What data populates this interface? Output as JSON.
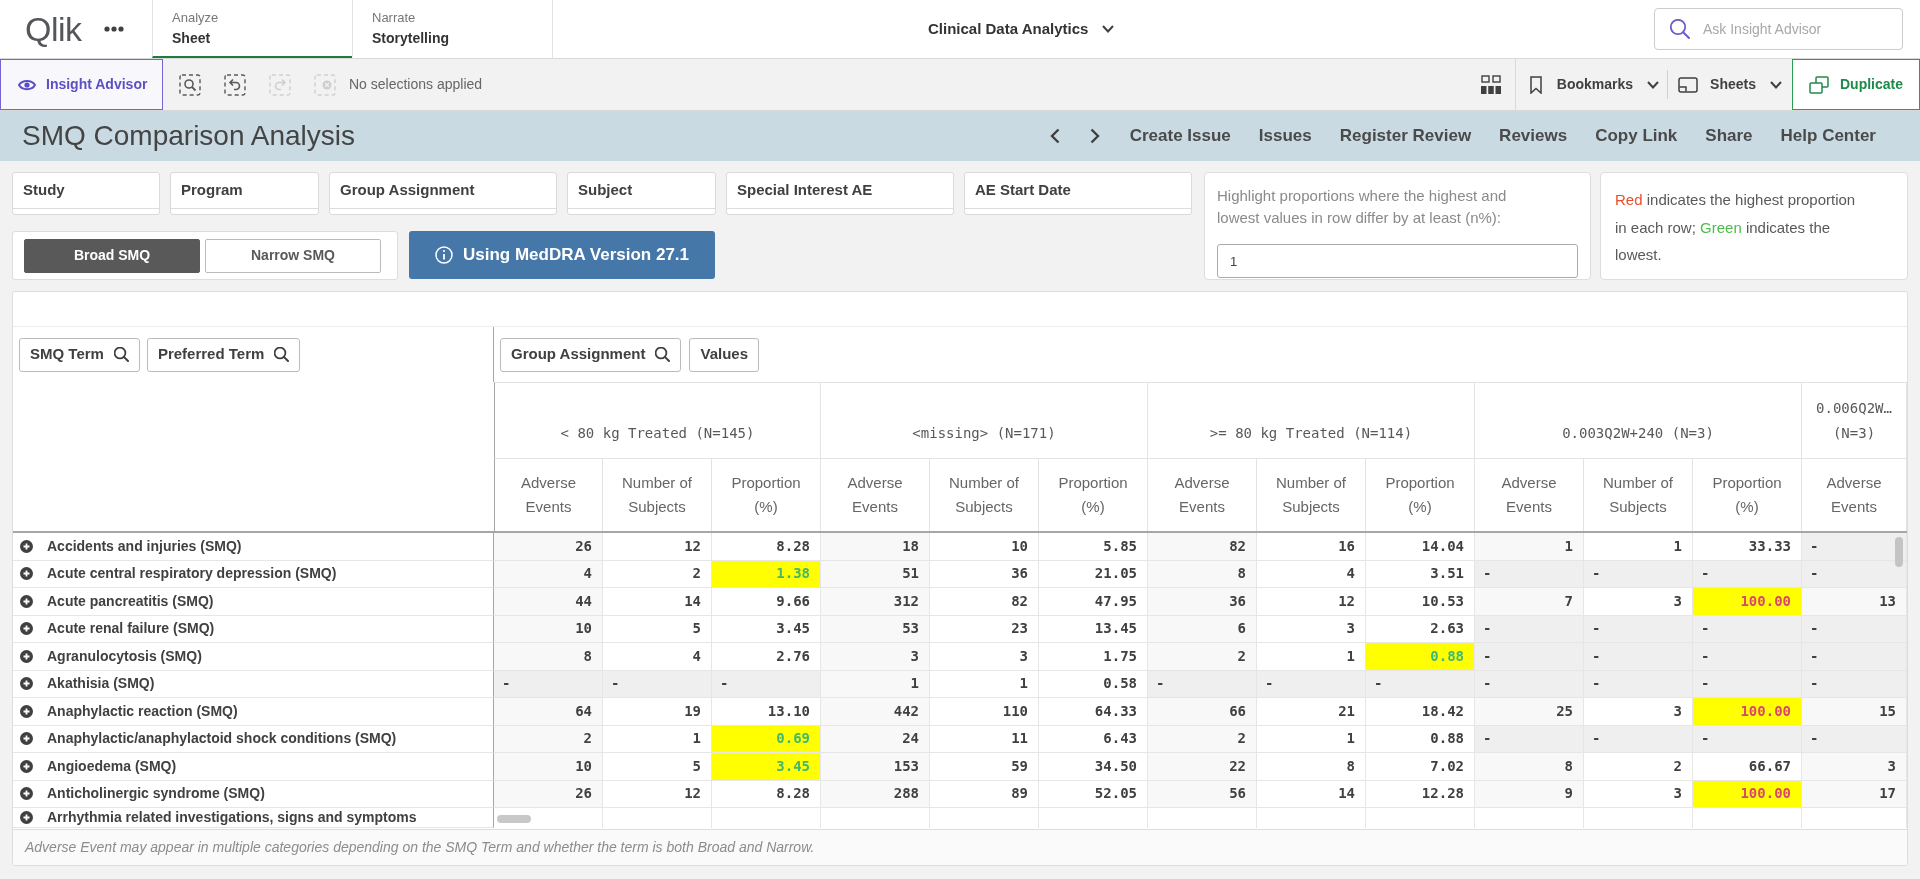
{
  "app_header": {
    "logo": "Qlik",
    "tabs": [
      {
        "category": "Analyze",
        "label": "Sheet",
        "selected": true
      },
      {
        "category": "Narrate",
        "label": "Storytelling",
        "selected": false
      }
    ],
    "app_title": "Clinical Data Analytics",
    "search": {
      "placeholder": "Ask Insight Advisor"
    }
  },
  "toolbar": {
    "insight_advisor": "Insight Advisor",
    "selection_tools": [
      {
        "kind": "search",
        "disabled": false
      },
      {
        "kind": "back",
        "disabled": false
      },
      {
        "kind": "forward",
        "disabled": true
      },
      {
        "kind": "clear",
        "disabled": true
      }
    ],
    "selections_status": "No selections applied",
    "bookmarks": "Bookmarks",
    "sheets": "Sheets",
    "duplicate": "Duplicate"
  },
  "sheet_bar": {
    "title": "SMQ Comparison Analysis",
    "links": [
      "Create Issue",
      "Issues",
      "Register Review",
      "Reviews",
      "Copy Link",
      "Share",
      "Help Center"
    ]
  },
  "filters": [
    "Study",
    "Program",
    "Group Assignment",
    "Subject",
    "Special Interest AE",
    "AE Start Date"
  ],
  "smq_scope": [
    {
      "label": "Broad SMQ",
      "selected": true
    },
    {
      "label": "Narrow SMQ",
      "selected": false
    }
  ],
  "meddra_button": "Using MedDRA Version 27.1",
  "highlight_setting": {
    "label": "Highlight proportions where the highest and lowest values in row differ by at least (n%):",
    "value": "1"
  },
  "legend": [
    {
      "text": "Red",
      "color": "#e94e2b"
    },
    {
      "text": "indicates the highest proportion in each row;",
      "color": "#595959"
    },
    {
      "text": "Green",
      "color": "#4cbb4c"
    },
    {
      "text": "indicates the lowest.",
      "color": "#595959"
    }
  ],
  "table": {
    "row_dimensions": [
      {
        "label": "SMQ Term",
        "search": true
      },
      {
        "label": "Preferred Term",
        "search": true
      }
    ],
    "column_dimensions": [
      {
        "label": "Group Assignment",
        "search": true
      },
      {
        "label": "Values",
        "search": false
      }
    ],
    "groups": [
      {
        "label": "< 80 kg Treated (N=145)",
        "columns": [
          "Adverse Events",
          "Number of Subjects",
          "Proportion (%)"
        ]
      },
      {
        "label": "<missing> (N=171)",
        "columns": [
          "Adverse Events",
          "Number of Subjects",
          "Proportion (%)"
        ]
      },
      {
        "label": ">= 80 kg Treated (N=114)",
        "columns": [
          "Adverse Events",
          "Number of Subjects",
          "Proportion (%)"
        ]
      },
      {
        "label": "0.003Q2W+240 (N=3)",
        "columns": [
          "Adverse Events",
          "Number of Subjects",
          "Proportion (%)"
        ]
      },
      {
        "label": "0.006Q2W… (N=3)",
        "columns": [
          "Adverse Events"
        ]
      }
    ],
    "rows": [
      {
        "term": "Accidents and injuries (SMQ)",
        "expanded": false,
        "groups": [
          {
            "adverse_events": "26",
            "subjects": "12",
            "proportion": "8.28",
            "highest": false,
            "lowest": false,
            "empty": false
          },
          {
            "adverse_events": "18",
            "subjects": "10",
            "proportion": "5.85",
            "highest": false,
            "lowest": false,
            "empty": false
          },
          {
            "adverse_events": "82",
            "subjects": "16",
            "proportion": "14.04",
            "highest": false,
            "lowest": false,
            "empty": false
          },
          {
            "adverse_events": "1",
            "subjects": "1",
            "proportion": "33.33",
            "highest": false,
            "lowest": false,
            "empty": false
          },
          {
            "adverse_events": "-",
            "empty": true
          }
        ]
      },
      {
        "term": "Acute central respiratory depression (SMQ)",
        "expanded": false,
        "groups": [
          {
            "adverse_events": "4",
            "subjects": "2",
            "proportion": "1.38",
            "highest": false,
            "lowest": true,
            "empty": false
          },
          {
            "adverse_events": "51",
            "subjects": "36",
            "proportion": "21.05",
            "highest": false,
            "lowest": false,
            "empty": false
          },
          {
            "adverse_events": "8",
            "subjects": "4",
            "proportion": "3.51",
            "highest": false,
            "lowest": false,
            "empty": false
          },
          {
            "adverse_events": "-",
            "subjects": "-",
            "proportion": "-",
            "highest": false,
            "lowest": false,
            "empty": true
          },
          {
            "adverse_events": "-",
            "empty": true
          }
        ]
      },
      {
        "term": "Acute pancreatitis (SMQ)",
        "expanded": false,
        "groups": [
          {
            "adverse_events": "44",
            "subjects": "14",
            "proportion": "9.66",
            "highest": false,
            "lowest": false,
            "empty": false
          },
          {
            "adverse_events": "312",
            "subjects": "82",
            "proportion": "47.95",
            "highest": false,
            "lowest": false,
            "empty": false
          },
          {
            "adverse_events": "36",
            "subjects": "12",
            "proportion": "10.53",
            "highest": false,
            "lowest": false,
            "empty": false
          },
          {
            "adverse_events": "7",
            "subjects": "3",
            "proportion": "100.00",
            "highest": true,
            "lowest": false,
            "empty": false
          },
          {
            "adverse_events": "13",
            "empty": false
          }
        ]
      },
      {
        "term": "Acute renal failure (SMQ)",
        "expanded": false,
        "groups": [
          {
            "adverse_events": "10",
            "subjects": "5",
            "proportion": "3.45",
            "highest": false,
            "lowest": false,
            "empty": false
          },
          {
            "adverse_events": "53",
            "subjects": "23",
            "proportion": "13.45",
            "highest": false,
            "lowest": false,
            "empty": false
          },
          {
            "adverse_events": "6",
            "subjects": "3",
            "proportion": "2.63",
            "highest": false,
            "lowest": false,
            "empty": false
          },
          {
            "adverse_events": "-",
            "subjects": "-",
            "proportion": "-",
            "highest": false,
            "lowest": false,
            "empty": true
          },
          {
            "adverse_events": "-",
            "empty": true
          }
        ]
      },
      {
        "term": "Agranulocytosis (SMQ)",
        "expanded": false,
        "groups": [
          {
            "adverse_events": "8",
            "subjects": "4",
            "proportion": "2.76",
            "highest": false,
            "lowest": false,
            "empty": false
          },
          {
            "adverse_events": "3",
            "subjects": "3",
            "proportion": "1.75",
            "highest": false,
            "lowest": false,
            "empty": false
          },
          {
            "adverse_events": "2",
            "subjects": "1",
            "proportion": "0.88",
            "highest": false,
            "lowest": true,
            "empty": false
          },
          {
            "adverse_events": "-",
            "subjects": "-",
            "proportion": "-",
            "highest": false,
            "lowest": false,
            "empty": true
          },
          {
            "adverse_events": "-",
            "empty": true
          }
        ]
      },
      {
        "term": "Akathisia (SMQ)",
        "expanded": false,
        "groups": [
          {
            "adverse_events": "-",
            "subjects": "-",
            "proportion": "-",
            "highest": false,
            "lowest": false,
            "empty": true
          },
          {
            "adverse_events": "1",
            "subjects": "1",
            "proportion": "0.58",
            "highest": false,
            "lowest": false,
            "empty": false
          },
          {
            "adverse_events": "-",
            "subjects": "-",
            "proportion": "-",
            "highest": false,
            "lowest": false,
            "empty": true
          },
          {
            "adverse_events": "-",
            "subjects": "-",
            "proportion": "-",
            "highest": false,
            "lowest": false,
            "empty": true
          },
          {
            "adverse_events": "-",
            "empty": true
          }
        ]
      },
      {
        "term": "Anaphylactic reaction (SMQ)",
        "expanded": false,
        "groups": [
          {
            "adverse_events": "64",
            "subjects": "19",
            "proportion": "13.10",
            "highest": false,
            "lowest": false,
            "empty": false
          },
          {
            "adverse_events": "442",
            "subjects": "110",
            "proportion": "64.33",
            "highest": false,
            "lowest": false,
            "empty": false
          },
          {
            "adverse_events": "66",
            "subjects": "21",
            "proportion": "18.42",
            "highest": false,
            "lowest": false,
            "empty": false
          },
          {
            "adverse_events": "25",
            "subjects": "3",
            "proportion": "100.00",
            "highest": true,
            "lowest": false,
            "empty": false
          },
          {
            "adverse_events": "15",
            "empty": false
          }
        ]
      },
      {
        "term": "Anaphylactic/anaphylactoid shock conditions (SMQ)",
        "expanded": false,
        "groups": [
          {
            "adverse_events": "2",
            "subjects": "1",
            "proportion": "0.69",
            "highest": false,
            "lowest": true,
            "empty": false
          },
          {
            "adverse_events": "24",
            "subjects": "11",
            "proportion": "6.43",
            "highest": false,
            "lowest": false,
            "empty": false
          },
          {
            "adverse_events": "2",
            "subjects": "1",
            "proportion": "0.88",
            "highest": false,
            "lowest": false,
            "empty": false
          },
          {
            "adverse_events": "-",
            "subjects": "-",
            "proportion": "-",
            "highest": false,
            "lowest": false,
            "empty": true
          },
          {
            "adverse_events": "-",
            "empty": true
          }
        ]
      },
      {
        "term": "Angioedema (SMQ)",
        "expanded": false,
        "groups": [
          {
            "adverse_events": "10",
            "subjects": "5",
            "proportion": "3.45",
            "highest": false,
            "lowest": true,
            "empty": false
          },
          {
            "adverse_events": "153",
            "subjects": "59",
            "proportion": "34.50",
            "highest": false,
            "lowest": false,
            "empty": false
          },
          {
            "adverse_events": "22",
            "subjects": "8",
            "proportion": "7.02",
            "highest": false,
            "lowest": false,
            "empty": false
          },
          {
            "adverse_events": "8",
            "subjects": "2",
            "proportion": "66.67",
            "highest": false,
            "lowest": false,
            "empty": false
          },
          {
            "adverse_events": "3",
            "empty": false
          }
        ]
      },
      {
        "term": "Anticholinergic syndrome (SMQ)",
        "expanded": false,
        "groups": [
          {
            "adverse_events": "26",
            "subjects": "12",
            "proportion": "8.28",
            "highest": false,
            "lowest": false,
            "empty": false
          },
          {
            "adverse_events": "288",
            "subjects": "89",
            "proportion": "52.05",
            "highest": false,
            "lowest": false,
            "empty": false
          },
          {
            "adverse_events": "56",
            "subjects": "14",
            "proportion": "12.28",
            "highest": false,
            "lowest": false,
            "empty": false
          },
          {
            "adverse_events": "9",
            "subjects": "3",
            "proportion": "100.00",
            "highest": true,
            "lowest": false,
            "empty": false
          },
          {
            "adverse_events": "17",
            "empty": false
          }
        ]
      },
      {
        "term": "Arrhythmia related investigations, signs and symptoms",
        "expanded": false
      }
    ],
    "footnote": "Adverse Event may appear in multiple categories depending on the SMQ Term and whether the term is both Broad and Narrow."
  }
}
